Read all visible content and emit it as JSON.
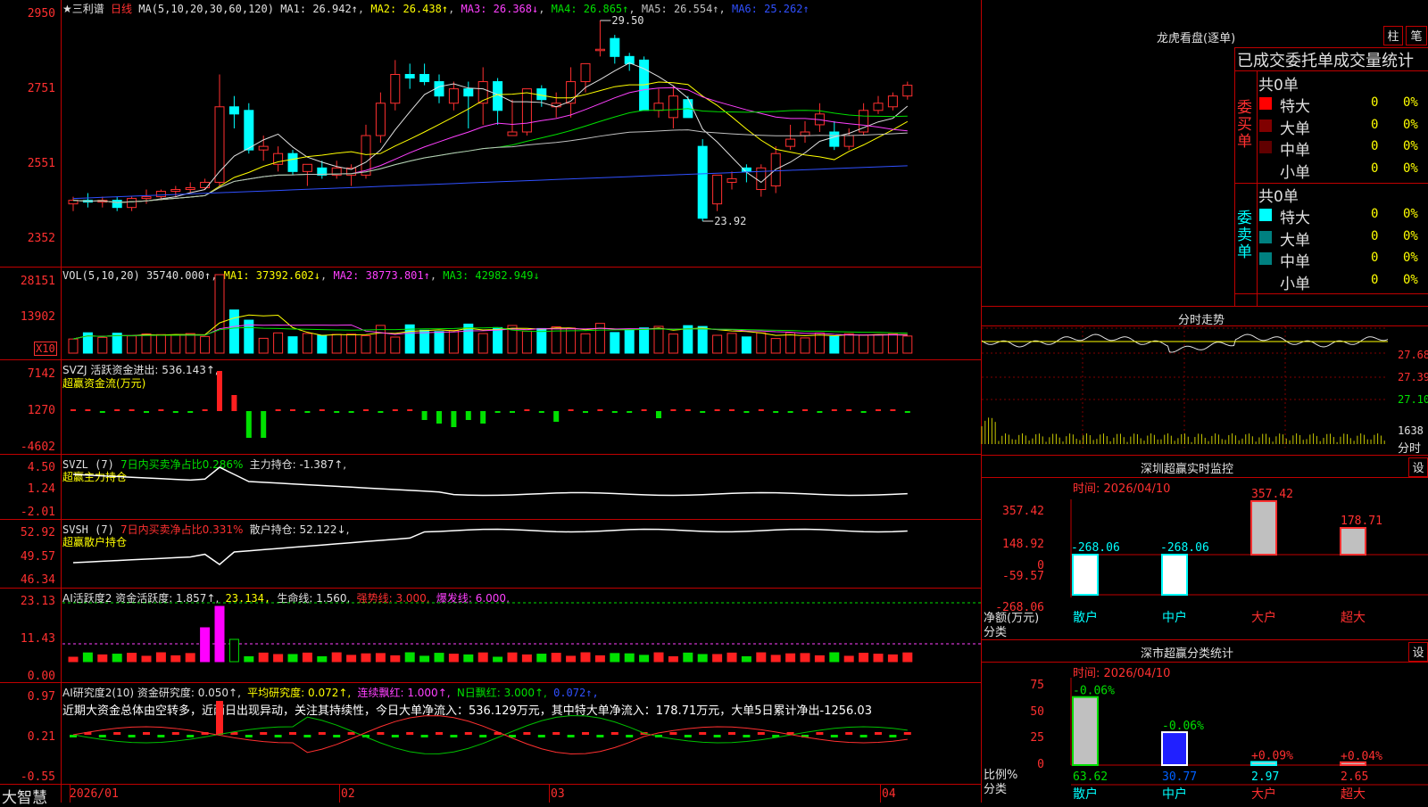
{
  "price": {
    "stock": "★三利谱",
    "period": "日线",
    "ma_label": "MA(5,10,20,30,60,120)",
    "mas": [
      {
        "label": "MA1: 26.942↑",
        "color": "#e0e0e0"
      },
      {
        "label": "MA2: 26.438↑",
        "color": "#ffff00"
      },
      {
        "label": "MA3: 26.368↓",
        "color": "#ff40ff"
      },
      {
        "label": "MA4: 26.865↑",
        "color": "#00e000"
      },
      {
        "label": "MA5: 26.554↑",
        "color": "#c0c0c0"
      },
      {
        "label": "MA6: 25.262↑",
        "color": "#3050ff"
      }
    ],
    "y_ticks": [
      "2950",
      "2751",
      "2551",
      "2352"
    ],
    "high_mark": "29.50",
    "low_mark": "23.92",
    "candles": [
      [
        24.4,
        24.6,
        24.2,
        24.5
      ],
      [
        24.5,
        24.7,
        24.3,
        24.45
      ],
      [
        24.45,
        24.6,
        24.3,
        24.5
      ],
      [
        24.5,
        24.6,
        24.2,
        24.3
      ],
      [
        24.3,
        24.6,
        24.2,
        24.55
      ],
      [
        24.55,
        24.8,
        24.4,
        24.6
      ],
      [
        24.6,
        24.8,
        24.5,
        24.75
      ],
      [
        24.75,
        24.9,
        24.6,
        24.8
      ],
      [
        24.8,
        25.0,
        24.7,
        24.85
      ],
      [
        24.85,
        25.1,
        24.8,
        25.0
      ],
      [
        25.0,
        28.0,
        24.9,
        27.1
      ],
      [
        27.1,
        27.4,
        26.5,
        26.9
      ],
      [
        27.0,
        27.2,
        25.8,
        25.9
      ],
      [
        25.9,
        26.3,
        25.6,
        26.0
      ],
      [
        25.5,
        26.0,
        25.3,
        25.8
      ],
      [
        25.8,
        25.9,
        25.2,
        25.3
      ],
      [
        25.3,
        25.5,
        24.9,
        25.5
      ],
      [
        25.4,
        25.6,
        25.1,
        25.2
      ],
      [
        25.2,
        25.6,
        25.1,
        25.4
      ],
      [
        25.2,
        25.5,
        24.9,
        25.4
      ],
      [
        25.2,
        26.6,
        25.1,
        26.3
      ],
      [
        26.3,
        27.5,
        26.1,
        27.2
      ],
      [
        27.2,
        28.4,
        27.0,
        28.0
      ],
      [
        28.0,
        28.3,
        27.6,
        27.9
      ],
      [
        28.0,
        28.3,
        27.7,
        27.8
      ],
      [
        27.8,
        28.0,
        27.2,
        27.4
      ],
      [
        27.2,
        27.8,
        27.0,
        27.6
      ],
      [
        27.6,
        27.8,
        26.5,
        27.4
      ],
      [
        27.2,
        28.2,
        26.6,
        27.8
      ],
      [
        27.8,
        27.9,
        26.6,
        27.0
      ],
      [
        26.3,
        27.3,
        26.3,
        26.4
      ],
      [
        26.4,
        27.5,
        26.3,
        27.6
      ],
      [
        27.6,
        27.7,
        27.1,
        27.3
      ],
      [
        27.1,
        27.5,
        26.8,
        27.2
      ],
      [
        27.2,
        28.2,
        26.8,
        27.8
      ],
      [
        27.8,
        28.3,
        27.5,
        28.3
      ],
      [
        28.7,
        29.5,
        28.5,
        28.7
      ],
      [
        29.0,
        29.1,
        28.3,
        28.5
      ],
      [
        28.5,
        28.6,
        28.1,
        28.3
      ],
      [
        28.4,
        28.5,
        27.0,
        27.0
      ],
      [
        27.0,
        27.6,
        26.8,
        27.2
      ],
      [
        26.8,
        27.7,
        26.5,
        27.4
      ],
      [
        27.3,
        27.4,
        26.8,
        26.8
      ],
      [
        26.0,
        26.2,
        23.92,
        24.0
      ],
      [
        24.4,
        25.2,
        24.2,
        25.2
      ],
      [
        25.0,
        25.3,
        24.8,
        25.1
      ],
      [
        25.4,
        25.5,
        25.0,
        25.3
      ],
      [
        24.8,
        25.5,
        24.6,
        25.4
      ],
      [
        24.9,
        26.0,
        24.7,
        25.8
      ],
      [
        26.0,
        26.6,
        25.9,
        26.2
      ],
      [
        26.3,
        26.7,
        26.1,
        26.4
      ],
      [
        26.6,
        27.2,
        26.4,
        26.9
      ],
      [
        26.4,
        26.7,
        25.9,
        26.0
      ],
      [
        26.0,
        26.5,
        25.9,
        26.3
      ],
      [
        26.4,
        27.2,
        26.3,
        27.0
      ],
      [
        27.0,
        27.4,
        26.9,
        27.2
      ],
      [
        27.1,
        27.5,
        27.0,
        27.4
      ],
      [
        27.4,
        27.8,
        27.3,
        27.7
      ]
    ]
  },
  "vol": {
    "label": "VOL(5,10,20)",
    "value": "35740.000↑",
    "mas": [
      {
        "label": "MA1: 37392.602↓",
        "color": "#ffff00"
      },
      {
        "label": "MA2: 38773.801↑",
        "color": "#ff40ff"
      },
      {
        "label": "MA3: 42982.949↓",
        "color": "#00e000"
      }
    ],
    "y_ticks": [
      "28151",
      "13902"
    ],
    "unit": "X10"
  },
  "svzj": {
    "label": "SVZJ  活跃资金进出: 536.143↑,",
    "subtitle": "超赢资金流(万元)",
    "y_ticks": [
      "7142",
      "1270",
      "-4602"
    ]
  },
  "svzl": {
    "label_a": "SVZL (7)",
    "label_b": "7日内买卖净占比0.286%",
    "label_c": "主力持仓: -1.387↑,",
    "subtitle": "超赢主力持仓",
    "y_ticks": [
      "4.50",
      "1.24",
      "-2.01"
    ]
  },
  "svsh": {
    "label_a": "SVSH (7)",
    "label_b": "7日内买卖净占比0.331%",
    "label_c": "散户持仓: 52.122↓,",
    "subtitle": "超赢散户持仓",
    "y_ticks": [
      "52.92",
      "49.57",
      "46.34"
    ]
  },
  "ai_active": {
    "label_a": "AI活跃度2 资金活跃度: 1.857↑,",
    "label_b": "23.134,",
    "label_c": "生命线: 1.560,",
    "label_d": "强势线: 3.000,",
    "label_e": "爆发线: 6.000,",
    "y_ticks": [
      "23.13",
      "11.43",
      "0.00"
    ]
  },
  "ai_research": {
    "label_a": "AI研究度2(10) 资金研究度: 0.050↑,",
    "label_b": "平均研究度: 0.072↑,",
    "label_c": "连续飘红: 1.000↑,",
    "label_d": "N日飘红: 3.000↑,",
    "label_e": "0.072↑,",
    "note": "近期大资金总体由空转多，近两日出现异动，关注其持续性，今日大单净流入：536.129万元，其中特大单净流入：178.71万元，大单5日累计净出-1256.03",
    "y_ticks": [
      "0.97",
      "0.21",
      "-0.55"
    ]
  },
  "x_axis": {
    "labels": [
      "2026/01",
      "02",
      "03",
      "04"
    ]
  },
  "brand": "大智慧",
  "right": {
    "lhb_title": "龙虎看盘(逐单)",
    "btn_zhu": "柱",
    "btn_bi": "笔",
    "stat_title": "已成交委托单成交量统计",
    "buy_side": "委买单",
    "sell_side": "委卖单",
    "buy_total": "共0单",
    "sell_total": "共0单",
    "buy_rows": [
      {
        "name": "特大",
        "value": "0",
        "pct": "0%",
        "color": "#ff0000"
      },
      {
        "name": "大单",
        "value": "0",
        "pct": "0%",
        "color": "#800000"
      },
      {
        "name": "中单",
        "value": "0",
        "pct": "0%",
        "color": "#600000"
      },
      {
        "name": "小单",
        "value": "0",
        "pct": "0%",
        "color": "#000000"
      }
    ],
    "sell_rows": [
      {
        "name": "特大",
        "value": "0",
        "pct": "0%",
        "color": "#00ffff"
      },
      {
        "name": "大单",
        "value": "0",
        "pct": "0%",
        "color": "#008080"
      },
      {
        "name": "中单",
        "value": "0",
        "pct": "0%",
        "color": "#008080"
      },
      {
        "name": "小单",
        "value": "0",
        "pct": "0%",
        "color": "#000000"
      }
    ],
    "fs_title": "分时走势",
    "fs_ticks": [
      "27.68",
      "27.39",
      "27.10",
      "1638",
      "分时"
    ],
    "sz_title": "深圳超赢实时监控",
    "sz_btn": "设",
    "sz_time": "时间: 2026/04/10",
    "sz_ticks": [
      "357.42",
      "148.92",
      "0",
      "-59.57",
      "-268.06"
    ],
    "sz_unit_a": "净额(万元)",
    "sz_unit_b": "分类",
    "sz_bars": [
      {
        "cat": "散户",
        "value": -268.06,
        "label": "-268.06"
      },
      {
        "cat": "中户",
        "value": -268.06,
        "label": "-268.06"
      },
      {
        "cat": "大户",
        "value": 357.42,
        "label": "357.42"
      },
      {
        "cat": "超大",
        "value": 178.71,
        "label": "178.71"
      }
    ],
    "fl_title": "深市超赢分类统计",
    "fl_btn": "设",
    "fl_time": "时间: 2026/04/10",
    "fl_ticks": [
      "75",
      "50",
      "25",
      "0"
    ],
    "fl_unit_a": "比例%",
    "fl_unit_b": "分类",
    "fl_bars": [
      {
        "cat": "散户",
        "value": 63.62,
        "label": "63.62",
        "delta": "-0.06%"
      },
      {
        "cat": "中户",
        "value": 30.77,
        "label": "30.77",
        "delta": "-0.06%"
      },
      {
        "cat": "大户",
        "value": 2.97,
        "label": "2.97",
        "delta": "+0.09%"
      },
      {
        "cat": "超大",
        "value": 2.65,
        "label": "2.65",
        "delta": "+0.04%"
      }
    ]
  }
}
